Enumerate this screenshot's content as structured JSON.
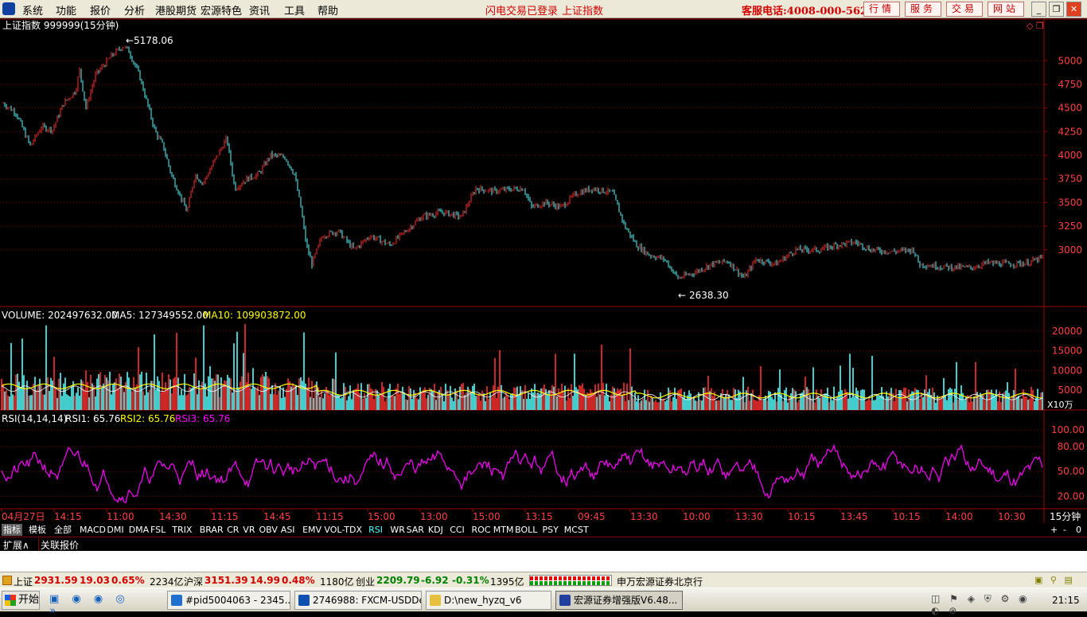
{
  "menu": {
    "items": [
      "系统",
      "功能",
      "报价",
      "分析",
      "港股期货",
      "宏源特色",
      "资讯",
      "工具",
      "帮助"
    ],
    "alert_login": "闪电交易已登录",
    "alert_index": "上证指数",
    "hotline": "客服电话:4008-000-562",
    "quick_buttons": [
      "行情",
      "服务",
      "交易",
      "网站"
    ]
  },
  "chart": {
    "header": "上证指数 999999(15分钟)",
    "high_label": "5178.06",
    "low_label": "2638.30",
    "price_ticks": [
      "5000",
      "4750",
      "4500",
      "4250",
      "4000",
      "3750",
      "3500",
      "3250",
      "3000"
    ],
    "volume": {
      "label": "VOLUME: 202497632.00",
      "ma5": "MA5: 127349552.00",
      "ma10": "MA10: 109903872.00",
      "ticks": [
        "20000",
        "15000",
        "10000",
        "5000"
      ],
      "unit": "X10万"
    },
    "rsi": {
      "label": "RSI(14,14,14)",
      "rsi1": "RSI1: 65.76",
      "rsi2": "RSI2: 65.76",
      "rsi3": "RSI3: 65.76",
      "ticks": [
        "100.00",
        "80.00",
        "50.00",
        "20.00"
      ]
    },
    "time_labels": [
      "04月27日",
      "14:15",
      "11:00",
      "14:30",
      "11:15",
      "14:45",
      "11:15",
      "15:00",
      "13:00",
      "15:00",
      "13:15",
      "09:45",
      "13:30",
      "10:00",
      "13:30",
      "10:15",
      "13:45",
      "10:15",
      "14:00",
      "10:30"
    ],
    "period": "15分钟",
    "colors": {
      "up": "#ff3030",
      "down": "#54ffff",
      "ma10": "#ffff00",
      "rsi": "#ff00ff",
      "grid": "#800000"
    }
  },
  "tabs": {
    "items": [
      "指标",
      "模板",
      "全部",
      "MACD",
      "DMI",
      "DMA",
      "FSL",
      "TRIX",
      "BRAR",
      "CR",
      "VR",
      "OBV",
      "ASI",
      "EMV",
      "VOL-TDX",
      "RSI",
      "WR",
      "SAR",
      "KDJ",
      "CCI",
      "ROC",
      "MTM",
      "BOLL",
      "PSY",
      "MCST"
    ],
    "controls": [
      "+",
      "-",
      "0"
    ]
  },
  "subtabs": [
    "扩展∧",
    "关联报价"
  ],
  "status": {
    "sh_name": "上证",
    "sh_value": "2931.59",
    "sh_change": "19.03",
    "sh_pct": "0.65%",
    "sh_amount": "2234亿",
    "hs_name": "沪深",
    "hs_value": "3151.39",
    "hs_change": "14.99",
    "hs_pct": "0.48%",
    "hs_amount": "1180亿",
    "cy_name": "创业",
    "cy_value": "2209.79",
    "cy_change": "-6.92",
    "cy_pct": "-0.31%",
    "cy_amount": "1395亿",
    "broker": "申万宏源证券北京行"
  },
  "taskbar": {
    "start": "开始",
    "tasks": [
      "#pid5004063 - 2345...",
      "2746988: FXCM-USDDe...",
      "D:\\new_hyzq_v6",
      "宏源证券增强版V6.48..."
    ],
    "clock": "21:15"
  }
}
